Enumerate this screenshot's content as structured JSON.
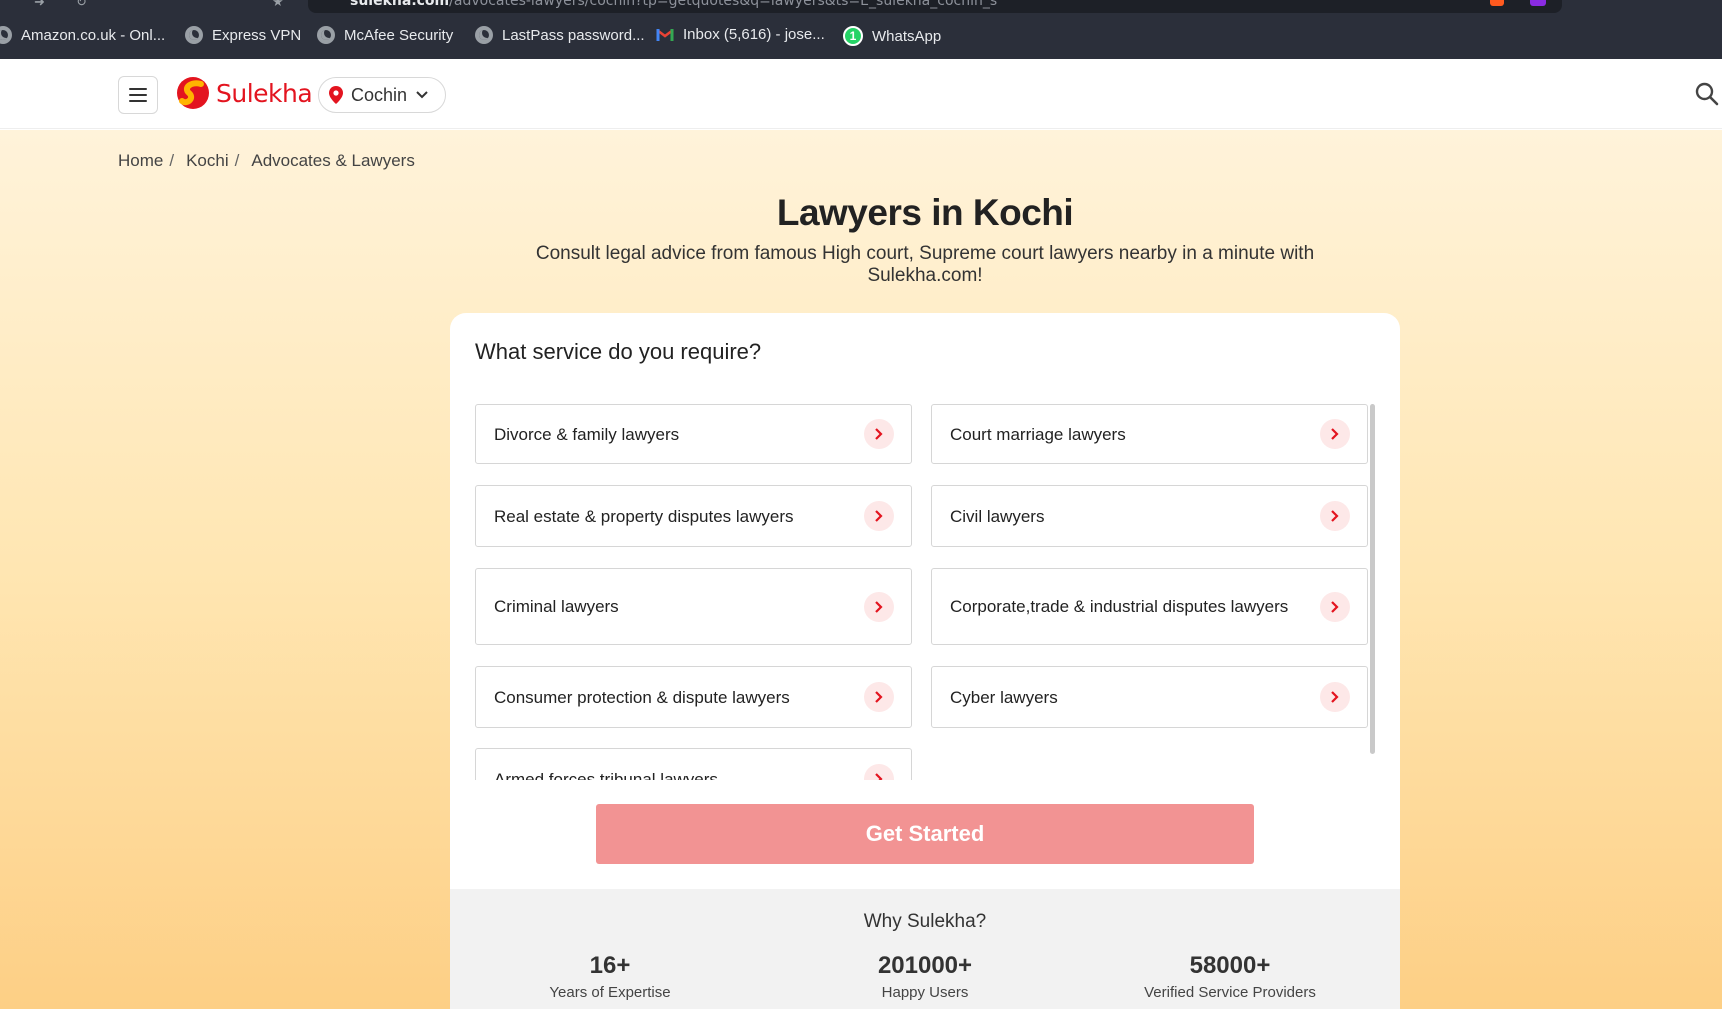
{
  "browser": {
    "url_domain": "sulekha.com",
    "url_path": "/advocates-lawyers/cochin?tp=getquotes&q=lawyers&ts=E_sulekha_cochin_s",
    "bookmarks": [
      {
        "label": "Amazon.co.uk - Onl...",
        "icon": "globe-icon"
      },
      {
        "label": "Express VPN",
        "icon": "globe-icon"
      },
      {
        "label": "McAfee Security",
        "icon": "globe-icon"
      },
      {
        "label": "LastPass password...",
        "icon": "globe-icon"
      },
      {
        "label": "Inbox (5,616) - jose...",
        "icon": "gmail-icon"
      },
      {
        "label": "WhatsApp",
        "icon": "whatsapp-icon"
      }
    ]
  },
  "header": {
    "logo_text": "Sulekha",
    "city": "Cochin",
    "brand_color": "#e3141f"
  },
  "breadcrumb": [
    "Home",
    "Kochi",
    "Advocates & Lawyers"
  ],
  "hero": {
    "title": "Lawyers in Kochi",
    "subtitle": "Consult legal advice from famous High court, Supreme court lawyers nearby in a minute with Sulekha.com!"
  },
  "card": {
    "question": "What service do you require?",
    "services": [
      "Divorce & family lawyers",
      "Court marriage lawyers",
      "Real estate & property disputes lawyers",
      "Civil lawyers",
      "Criminal lawyers",
      "Corporate,trade & industrial disputes lawyers",
      "Consumer protection & dispute lawyers",
      "Cyber lawyers",
      "Armed forces tribunal lawyers"
    ],
    "cta_label": "Get Started",
    "cta_color": "#f29393"
  },
  "why": {
    "title": "Why Sulekha?",
    "stats": [
      {
        "value": "16+",
        "label": "Years of Expertise"
      },
      {
        "value": "201000+",
        "label": "Happy Users"
      },
      {
        "value": "58000+",
        "label": "Verified Service Providers"
      }
    ]
  }
}
